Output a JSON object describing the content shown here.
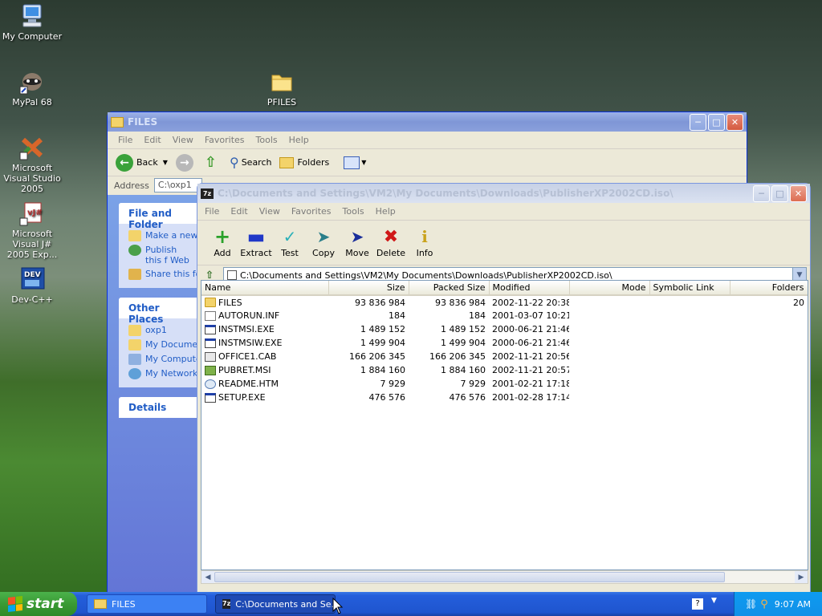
{
  "desktop": {
    "icons": [
      {
        "label": "My Computer"
      },
      {
        "label": "MyPal 68"
      },
      {
        "label": "PFILES"
      },
      {
        "label": "Microsoft Visual Studio 2005"
      },
      {
        "label": "Microsoft Visual J# 2005 Exp..."
      },
      {
        "label": "Dev-C++"
      }
    ]
  },
  "files_window": {
    "title": "FILES",
    "menu": [
      "File",
      "Edit",
      "View",
      "Favorites",
      "Tools",
      "Help"
    ],
    "toolbar": {
      "back": "Back",
      "search": "Search",
      "folders": "Folders"
    },
    "address_label": "Address",
    "address_value": "C:\\oxp1",
    "tasks_title": "File and Folder",
    "tasks": [
      "Make a new",
      "Publish this f Web",
      "Share this fo"
    ],
    "other_places_title": "Other Places",
    "other_places": [
      "oxp1",
      "My Documer",
      "My Compute",
      "My Network"
    ],
    "details_title": "Details"
  },
  "zip_window": {
    "title": "C:\\Documents and Settings\\VM2\\My Documents\\Downloads\\PublisherXP2002CD.iso\\",
    "menu": [
      "File",
      "Edit",
      "View",
      "Favorites",
      "Tools",
      "Help"
    ],
    "toolbar": [
      "Add",
      "Extract",
      "Test",
      "Copy",
      "Move",
      "Delete",
      "Info"
    ],
    "path": "C:\\Documents and Settings\\VM2\\My Documents\\Downloads\\PublisherXP2002CD.iso\\",
    "columns": [
      "Name",
      "Size",
      "Packed Size",
      "Modified",
      "Mode",
      "Symbolic Link",
      "Folders"
    ],
    "rows": [
      {
        "name": "FILES",
        "type": "folder",
        "size": "93 836 984",
        "packed": "93 836 984",
        "modified": "2002-11-22 20:38",
        "folders": "20"
      },
      {
        "name": "AUTORUN.INF",
        "type": "inf",
        "size": "184",
        "packed": "184",
        "modified": "2001-03-07 10:21",
        "folders": ""
      },
      {
        "name": "INSTMSI.EXE",
        "type": "exe",
        "size": "1 489 152",
        "packed": "1 489 152",
        "modified": "2000-06-21 21:46",
        "folders": ""
      },
      {
        "name": "INSTMSIW.EXE",
        "type": "exe",
        "size": "1 499 904",
        "packed": "1 499 904",
        "modified": "2000-06-21 21:46",
        "folders": ""
      },
      {
        "name": "OFFICE1.CAB",
        "type": "cab",
        "size": "166 206 345",
        "packed": "166 206 345",
        "modified": "2002-11-21 20:56",
        "folders": ""
      },
      {
        "name": "PUBRET.MSI",
        "type": "msi",
        "size": "1 884 160",
        "packed": "1 884 160",
        "modified": "2002-11-21 20:57",
        "folders": ""
      },
      {
        "name": "README.HTM",
        "type": "htm",
        "size": "7 929",
        "packed": "7 929",
        "modified": "2001-02-21 17:18",
        "folders": ""
      },
      {
        "name": "SETUP.EXE",
        "type": "exe",
        "size": "476 576",
        "packed": "476 576",
        "modified": "2001-02-28 17:14",
        "folders": ""
      }
    ]
  },
  "taskbar": {
    "start": "start",
    "tasks": [
      "FILES",
      "C:\\Documents and Se..."
    ],
    "clock": "9:07 AM"
  }
}
